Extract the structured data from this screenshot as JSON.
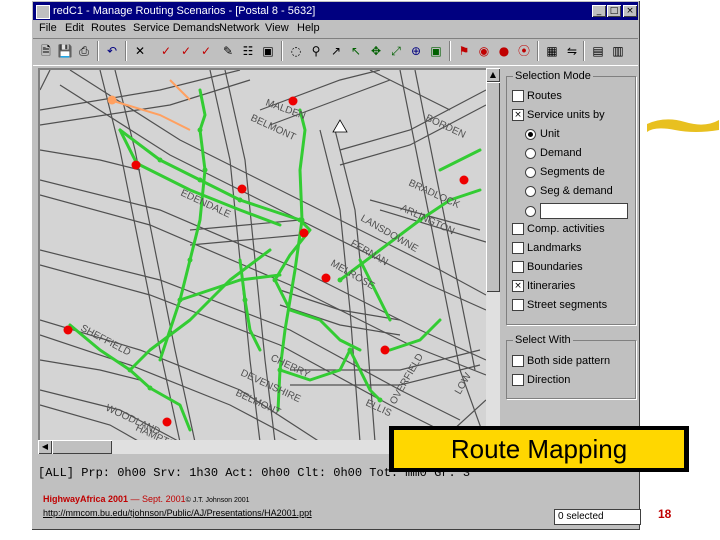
{
  "window": {
    "title": "redC1 - Manage Routing Scenarios - [Postal  8 - 5632]",
    "controls": [
      "_",
      "□",
      "×"
    ]
  },
  "menu": {
    "items": [
      "File",
      "Edit",
      "Routes",
      "Service Demands",
      "Network",
      "View",
      "Help"
    ]
  },
  "map": {
    "street_labels": [
      "MALDEN",
      "BELMONT",
      "BORDEN",
      "BRADLOCK",
      "ARLINGTON",
      "LANSDOWNE",
      "FERNAN",
      "MELROSE",
      "EDENDALE",
      "SHEFFIELD",
      "CHERRY",
      "DEVENSHIRE",
      "BELMONT",
      "ELLIS",
      "OVERFIELD",
      "LOW",
      "WOODLAND",
      "HAMPTON"
    ],
    "colors": {
      "route": "#33cc33",
      "stop": "#ee0000",
      "depot": "#ffa060",
      "street": "#505050",
      "background": "#d4d4d4"
    }
  },
  "selection_mode": {
    "legend": "Selection Mode",
    "routes": "Routes",
    "service_units": "Service units by",
    "unit": "Unit",
    "demand": "Demand",
    "segments_de": "Segments de",
    "seg_demand": "Seg & demand",
    "comp_activities": "Comp. activities",
    "landmarks": "Landmarks",
    "boundaries": "Boundaries",
    "itineraries": "Itineraries",
    "street_segments": "Street segments",
    "checked_mark": "×"
  },
  "select_with": {
    "legend": "Select With",
    "both_side": "Both side pattern",
    "direction": "Direction"
  },
  "status_bar": {
    "text": "[ALL]  Prp: 0h00  Srv: 1h30  Act: 0h00  Clt: 0h00  Tot: mm0  Gr: 3"
  },
  "footer": {
    "line1_a": "HighwayAfrica 2001",
    "line1_b": " — Sept. 2001",
    "line1_c": "© J.T. Johnson 2001",
    "line2": "http://mmcom.bu.edu/tjohnson/Public/AJ/Presentations/HA2001.ppt",
    "selected_box": "0 selected"
  },
  "callout": {
    "text": "Route Mapping"
  },
  "page_number": "18"
}
